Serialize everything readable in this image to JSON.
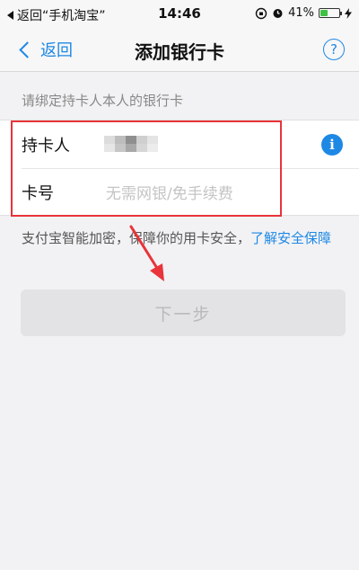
{
  "status_bar": {
    "back_app": "返回“手机淘宝”",
    "time": "14:46",
    "battery_text": "41%",
    "battery_level": 0.41,
    "battery_color": "#3ec144"
  },
  "nav": {
    "back_label": "返回",
    "title": "添加银行卡",
    "help_icon": "question-circle-icon",
    "help_glyph": "?"
  },
  "form": {
    "section_label": "请绑定持卡人本人的银行卡",
    "cardholder_label": "持卡人",
    "card_number_label": "卡号",
    "card_number_placeholder": "无需网银/免手续费",
    "info_icon": "info-circle-icon",
    "info_glyph": "i"
  },
  "security": {
    "text": "支付宝智能加密，保障你的用卡安全，",
    "link": "了解安全保障"
  },
  "next_button": {
    "label": "下一步"
  },
  "colors": {
    "accent": "#1e88e5",
    "annotation": "#e8343a",
    "disabled_button": "#e3e3e5"
  }
}
